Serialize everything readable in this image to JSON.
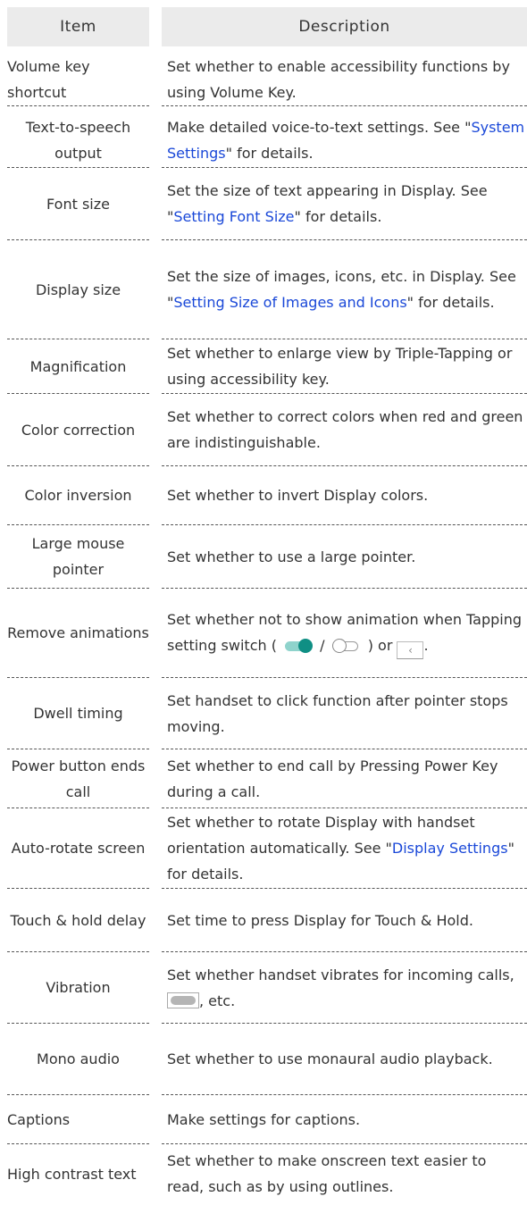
{
  "header": {
    "item": "Item",
    "description": "Description"
  },
  "rows": [
    {
      "item": "Volume key shortcut",
      "desc": "Set whether to enable accessibility functions by using Volume Key."
    },
    {
      "item": "Text-to-speech output",
      "desc_pre": "Make detailed voice-to-text settings. See \"",
      "desc_link": "System Settings",
      "desc_post": "\" for details."
    },
    {
      "item": "Font size",
      "desc_pre": "Set the size of text appearing in Display. See \"",
      "desc_link": "Setting Font Size",
      "desc_post": "\" for details."
    },
    {
      "item": "Display size",
      "desc_pre": "Set the size of images, icons, etc. in Display. See \"",
      "desc_link": "Setting Size of Images and Icons",
      "desc_post": "\" for details."
    },
    {
      "item": "Magnification",
      "desc": "Set whether to enlarge view by Triple-Tapping or using accessibility key."
    },
    {
      "item": "Color correction",
      "desc": "Set whether to correct colors when red and green are indistinguishable."
    },
    {
      "item": "Color inversion",
      "desc": "Set whether to invert Display colors."
    },
    {
      "item": "Large mouse pointer",
      "desc": "Set whether to use a large pointer."
    },
    {
      "item": "Remove animations",
      "desc_pre": "Set whether not to show animation when Tapping setting switch ( ",
      "desc_mid": " / ",
      "desc_mid2": " ) or ",
      "desc_post": "."
    },
    {
      "item": "Dwell timing",
      "desc": "Set handset to click function after pointer stops moving."
    },
    {
      "item": "Power button ends call",
      "desc": "Set whether to end call by Pressing Power Key during a call."
    },
    {
      "item": "Auto-rotate screen",
      "desc_pre": "Set whether to rotate Display with handset orientation automatically. See \"",
      "desc_link": "Display Settings",
      "desc_post": "\" for details."
    },
    {
      "item": "Touch & hold delay",
      "desc": "Set time to press Display for Touch & Hold."
    },
    {
      "item": "Vibration",
      "desc_pre": "Set whether handset vibrates for incoming calls, ",
      "desc_post": ", etc."
    },
    {
      "item": "Mono audio",
      "desc": "Set whether to use monaural audio playback."
    },
    {
      "item": "Captions",
      "desc": "Make settings for captions."
    },
    {
      "item": "High contrast text",
      "desc": "Set whether to make onscreen text easier to read, such as by using outlines."
    }
  ],
  "icons": {
    "toggle_on": "toggle-on-icon",
    "toggle_off": "toggle-off-icon",
    "back_key": "back-key-icon",
    "vibration_key": "vibration-key-icon"
  },
  "colors": {
    "link": "#1a48d8",
    "header_bg": "#ebebeb",
    "toggle_on": "#0f8f84"
  }
}
